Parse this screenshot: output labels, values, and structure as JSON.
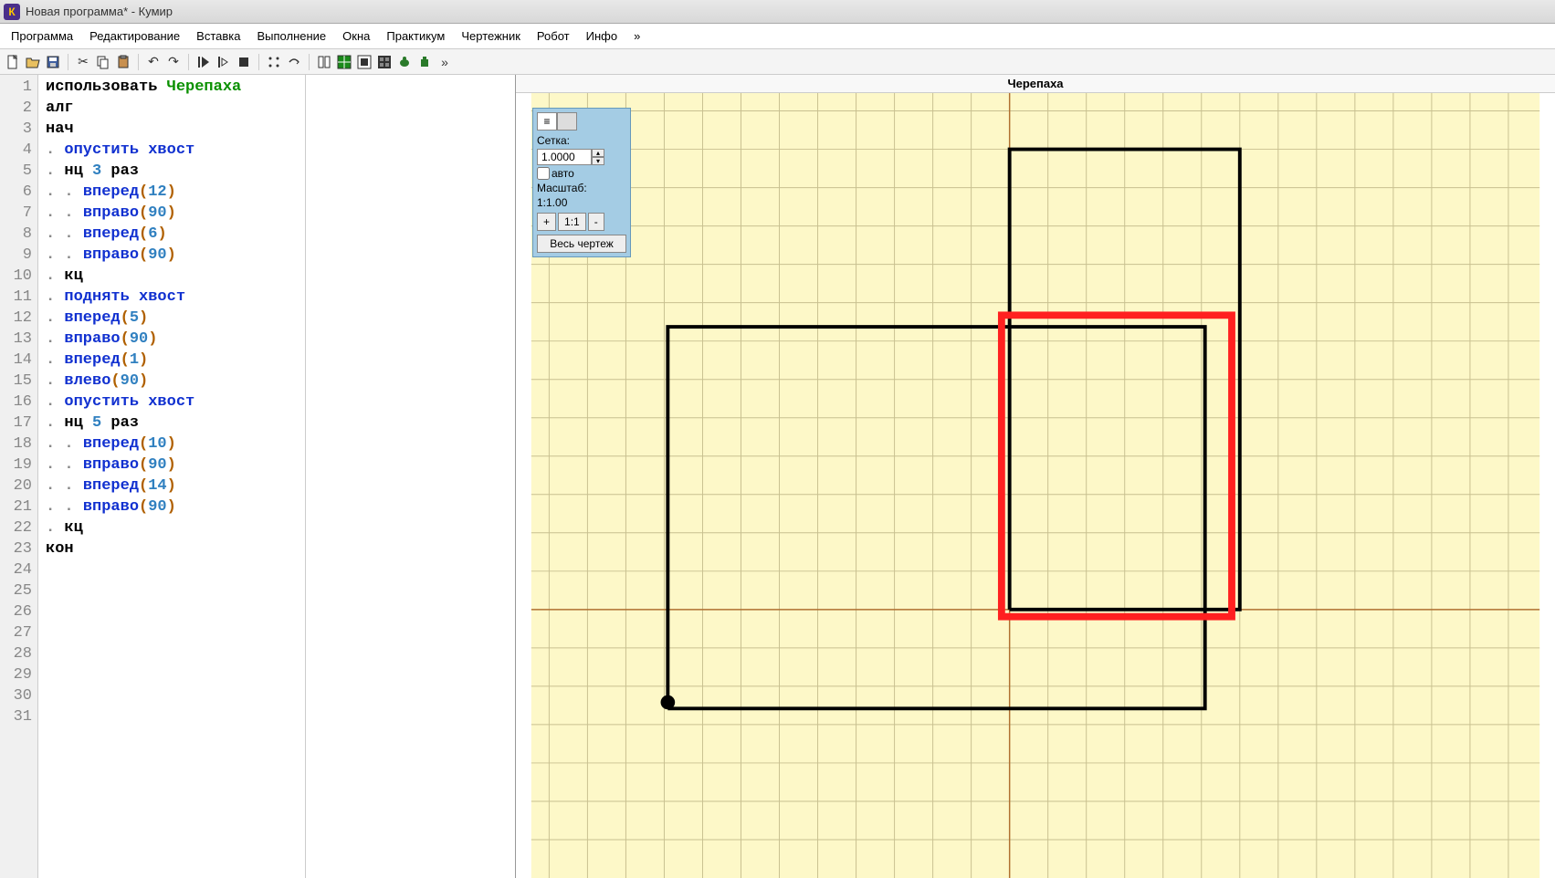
{
  "titlebar": {
    "app_icon": "К",
    "title": "Новая программа* - Кумир"
  },
  "menubar": [
    "Программа",
    "Редактирование",
    "Вставка",
    "Выполнение",
    "Окна",
    "Практикум",
    "Чертежник",
    "Робот",
    "Инфо",
    "»"
  ],
  "code": {
    "lines": [
      [
        {
          "t": "использовать ",
          "c": "kw"
        },
        {
          "t": "Черепаха",
          "c": "ident"
        }
      ],
      [
        {
          "t": "алг",
          "c": "kw"
        }
      ],
      [
        {
          "t": "нач",
          "c": "kw"
        }
      ],
      [
        {
          "t": ". ",
          "c": "dot"
        },
        {
          "t": "опустить хвост",
          "c": "cmd"
        }
      ],
      [
        {
          "t": ". ",
          "c": "dot"
        },
        {
          "t": "нц ",
          "c": "kw"
        },
        {
          "t": "3",
          "c": "num"
        },
        {
          "t": " раз",
          "c": "kw"
        }
      ],
      [
        {
          "t": ". . ",
          "c": "dot"
        },
        {
          "t": "вперед",
          "c": "cmd"
        },
        {
          "t": "(",
          "c": "punct"
        },
        {
          "t": "12",
          "c": "num"
        },
        {
          "t": ")",
          "c": "punct"
        }
      ],
      [
        {
          "t": ". . ",
          "c": "dot"
        },
        {
          "t": "вправо",
          "c": "cmd"
        },
        {
          "t": "(",
          "c": "punct"
        },
        {
          "t": "90",
          "c": "num"
        },
        {
          "t": ")",
          "c": "punct"
        }
      ],
      [
        {
          "t": ". . ",
          "c": "dot"
        },
        {
          "t": "вперед",
          "c": "cmd"
        },
        {
          "t": "(",
          "c": "punct"
        },
        {
          "t": "6",
          "c": "num"
        },
        {
          "t": ")",
          "c": "punct"
        }
      ],
      [
        {
          "t": ". . ",
          "c": "dot"
        },
        {
          "t": "вправо",
          "c": "cmd"
        },
        {
          "t": "(",
          "c": "punct"
        },
        {
          "t": "90",
          "c": "num"
        },
        {
          "t": ")",
          "c": "punct"
        }
      ],
      [
        {
          "t": ". ",
          "c": "dot"
        },
        {
          "t": "кц",
          "c": "kw"
        }
      ],
      [
        {
          "t": ". ",
          "c": "dot"
        },
        {
          "t": "поднять хвост",
          "c": "cmd"
        }
      ],
      [
        {
          "t": ". ",
          "c": "dot"
        },
        {
          "t": "вперед",
          "c": "cmd"
        },
        {
          "t": "(",
          "c": "punct"
        },
        {
          "t": "5",
          "c": "num"
        },
        {
          "t": ")",
          "c": "punct"
        }
      ],
      [
        {
          "t": ". ",
          "c": "dot"
        },
        {
          "t": "вправо",
          "c": "cmd"
        },
        {
          "t": "(",
          "c": "punct"
        },
        {
          "t": "90",
          "c": "num"
        },
        {
          "t": ")",
          "c": "punct"
        }
      ],
      [
        {
          "t": ". ",
          "c": "dot"
        },
        {
          "t": "вперед",
          "c": "cmd"
        },
        {
          "t": "(",
          "c": "punct"
        },
        {
          "t": "1",
          "c": "num"
        },
        {
          "t": ")",
          "c": "punct"
        }
      ],
      [
        {
          "t": ". ",
          "c": "dot"
        },
        {
          "t": "влево",
          "c": "cmd"
        },
        {
          "t": "(",
          "c": "punct"
        },
        {
          "t": "90",
          "c": "num"
        },
        {
          "t": ")",
          "c": "punct"
        }
      ],
      [
        {
          "t": ". ",
          "c": "dot"
        },
        {
          "t": "опустить хвост",
          "c": "cmd"
        }
      ],
      [
        {
          "t": ". ",
          "c": "dot"
        },
        {
          "t": "нц ",
          "c": "kw"
        },
        {
          "t": "5",
          "c": "num"
        },
        {
          "t": " раз",
          "c": "kw"
        }
      ],
      [
        {
          "t": ". . ",
          "c": "dot"
        },
        {
          "t": "вперед",
          "c": "cmd"
        },
        {
          "t": "(",
          "c": "punct"
        },
        {
          "t": "10",
          "c": "num"
        },
        {
          "t": ")",
          "c": "punct"
        }
      ],
      [
        {
          "t": ". . ",
          "c": "dot"
        },
        {
          "t": "вправо",
          "c": "cmd"
        },
        {
          "t": "(",
          "c": "punct"
        },
        {
          "t": "90",
          "c": "num"
        },
        {
          "t": ")",
          "c": "punct"
        }
      ],
      [
        {
          "t": ". . ",
          "c": "dot"
        },
        {
          "t": "вперед",
          "c": "cmd"
        },
        {
          "t": "(",
          "c": "punct"
        },
        {
          "t": "14",
          "c": "num"
        },
        {
          "t": ")",
          "c": "punct"
        }
      ],
      [
        {
          "t": ". . ",
          "c": "dot"
        },
        {
          "t": "вправо",
          "c": "cmd"
        },
        {
          "t": "(",
          "c": "punct"
        },
        {
          "t": "90",
          "c": "num"
        },
        {
          "t": ")",
          "c": "punct"
        }
      ],
      [
        {
          "t": ". ",
          "c": "dot"
        },
        {
          "t": "кц",
          "c": "kw"
        }
      ],
      [
        {
          "t": "кон",
          "c": "kw"
        }
      ]
    ],
    "total_lines": 31
  },
  "output": {
    "title": "Черепаха",
    "controls": {
      "grid_label": "Сетка:",
      "grid_value": "1.0000",
      "auto_label": "авто",
      "scale_label": "Масштаб:",
      "scale_value": "1:1.00",
      "btn_plus": "+",
      "btn_one": "1:1",
      "btn_minus": "-",
      "btn_full": "Весь чертеж"
    }
  }
}
